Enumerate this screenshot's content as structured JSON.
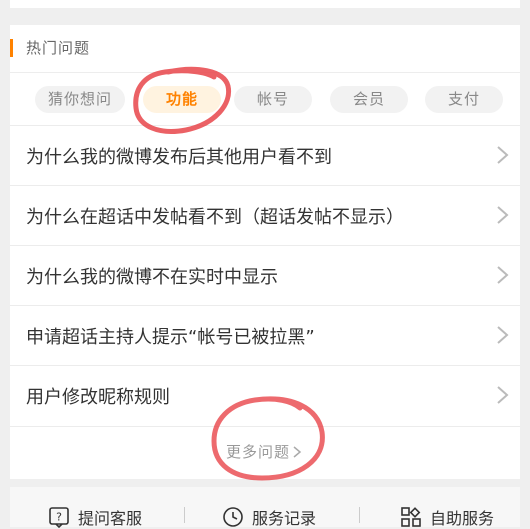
{
  "section": {
    "title": "热门问题"
  },
  "tabs": [
    "猜你想问",
    "功能",
    "帐号",
    "会员",
    "支付"
  ],
  "active_tab": "功能",
  "questions": [
    "为什么我的微博发布后其他用户看不到",
    "为什么在超话中发帖看不到（超话发帖不显示）",
    "为什么我的微博不在实时中显示",
    "申请超话主持人提示“帐号已被拉黑”",
    "用户修改昵称规则"
  ],
  "more_label": "更多问题",
  "bottom_bar": {
    "items": [
      {
        "label": "提问客服",
        "icon": "question-chat-icon"
      },
      {
        "label": "服务记录",
        "icon": "clock-icon"
      },
      {
        "label": "自助服务",
        "icon": "grid-icon"
      }
    ]
  },
  "colors": {
    "accent": "#ff8200",
    "annotation": "#e8454a"
  }
}
